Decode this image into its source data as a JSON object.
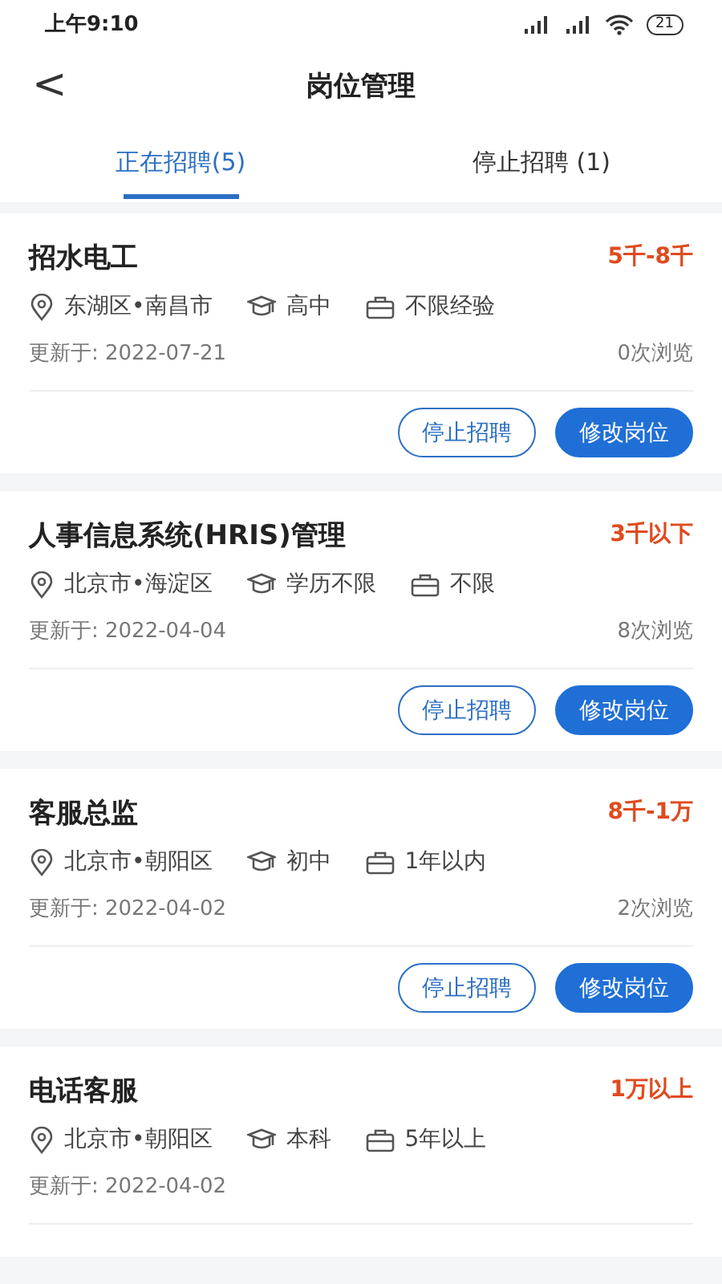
{
  "status_bar": {
    "time": "上午9:10",
    "battery": "21"
  },
  "header": {
    "back": "<",
    "title": "岗位管理"
  },
  "tabs": [
    {
      "label": "正在招聘(5)",
      "selected": true
    },
    {
      "label": "停止招聘 (1)",
      "selected": false
    }
  ],
  "jobs": [
    {
      "title": "招水电工",
      "salary": "5千-8千",
      "location": "东湖区•南昌市",
      "education": "高中",
      "experience": "不限经验",
      "updated": "更新于: 2022-07-21",
      "views": "0次浏览",
      "buttons": [
        "停止招聘",
        "修改岗位"
      ]
    },
    {
      "title": "人事信息系统(HRIS)管理",
      "salary": "3千以下",
      "location": "北京市•海淀区",
      "education": "学历不限",
      "experience": "不限",
      "updated": "更新于: 2022-04-04",
      "views": "8次浏览",
      "buttons": [
        "停止招聘",
        "修改岗位"
      ]
    },
    {
      "title": "客服总监",
      "salary": "8千-1万",
      "location": "北京市•朝阳区",
      "education": "初中",
      "experience": "1年以内",
      "updated": "更新于: 2022-04-02",
      "views": "2次浏览",
      "buttons": [
        "停止招聘",
        "修改岗位"
      ]
    },
    {
      "title": "电话客服",
      "salary": "1万以上",
      "location": "北京市•朝阳区",
      "education": "本科",
      "experience": "5年以上",
      "updated": "更新于: 2022-04-02"
    }
  ]
}
